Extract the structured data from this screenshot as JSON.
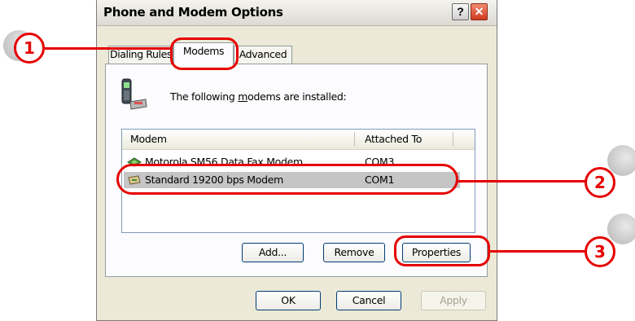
{
  "window": {
    "title": "Phone and Modem Options"
  },
  "tabs": [
    {
      "label": "Dialing Rules"
    },
    {
      "label": "Modems"
    },
    {
      "label": "Advanced"
    }
  ],
  "modems_tab": {
    "description_before": "The following ",
    "description_mnemonic": "m",
    "description_after": "odems are  installed:",
    "columns": [
      "Modem",
      "Attached To"
    ],
    "rows": [
      {
        "name": "Motorola SM56 Data Fax Modem",
        "port": "COM3",
        "icon": "network-modem-icon"
      },
      {
        "name": "Standard 19200 bps Modem",
        "port": "COM1",
        "icon": "modem-icon",
        "selected": true
      }
    ],
    "buttons": {
      "add": "Add...",
      "remove": "Remove",
      "properties": "Properties"
    }
  },
  "footer": {
    "ok": "OK",
    "cancel": "Cancel",
    "apply": "Apply"
  },
  "annotations": {
    "badge1": "1",
    "badge2": "2",
    "badge3": "3"
  },
  "colors": {
    "annotation": "#e60000",
    "selection": "#c5c5c5"
  }
}
